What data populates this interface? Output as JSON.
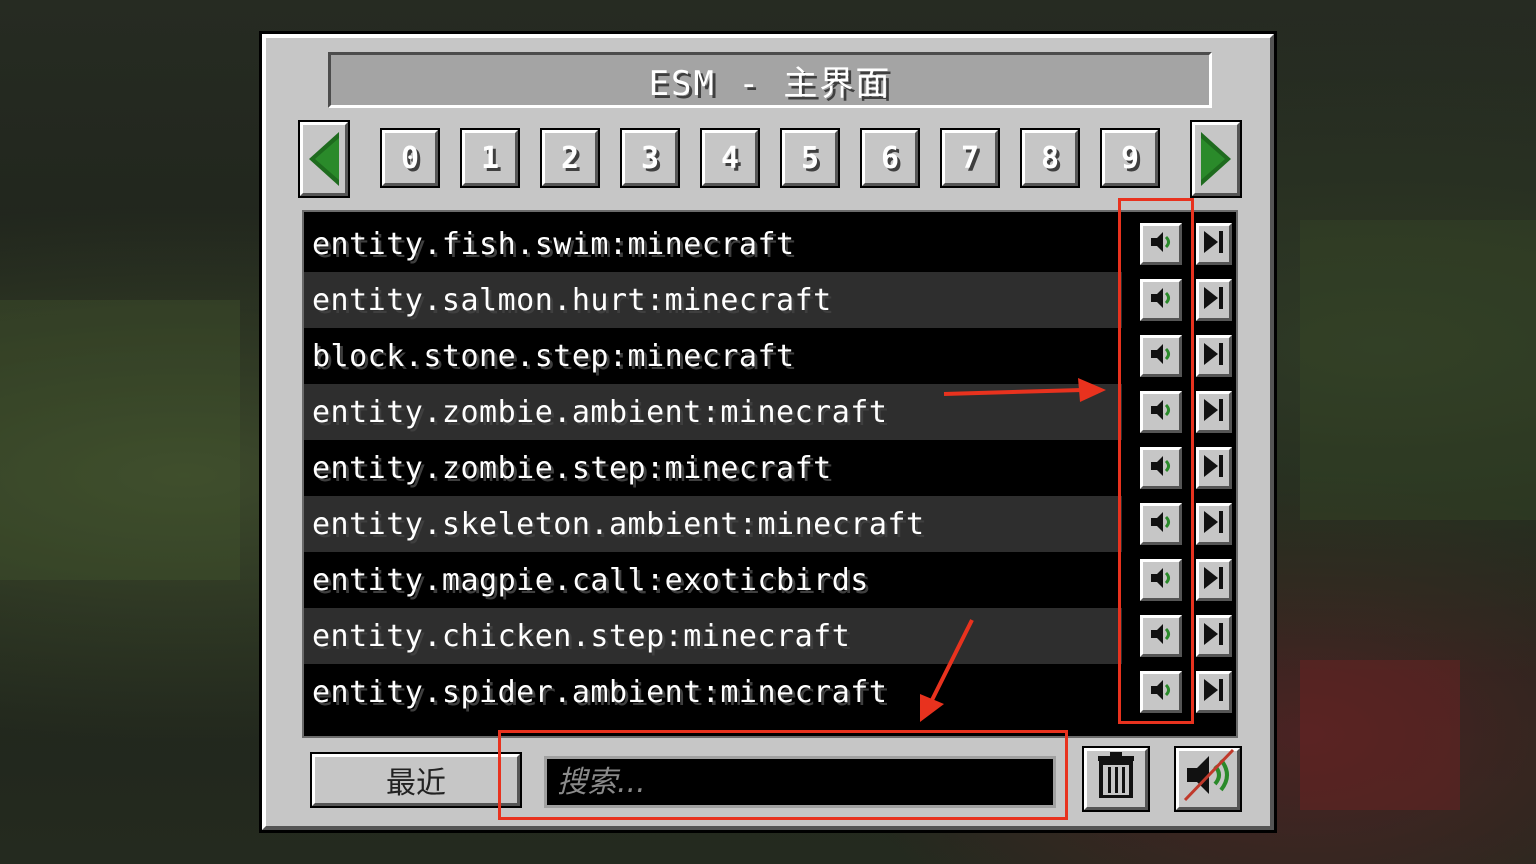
{
  "window": {
    "title": "ESM - 主界面"
  },
  "pagination": {
    "prev_icon": "green-left-arrow-icon",
    "next_icon": "green-right-arrow-icon",
    "pages": [
      "0",
      "1",
      "2",
      "3",
      "4",
      "5",
      "6",
      "7",
      "8",
      "9"
    ]
  },
  "sounds": [
    "entity.fish.swim:minecraft",
    "entity.salmon.hurt:minecraft",
    "block.stone.step:minecraft",
    "entity.zombie.ambient:minecraft",
    "entity.zombie.step:minecraft",
    "entity.skeleton.ambient:minecraft",
    "entity.magpie.call:exoticbirds",
    "entity.chicken.step:minecraft",
    "entity.spider.ambient:minecraft"
  ],
  "row_actions": {
    "play_icon": "speaker-icon",
    "stop_icon": "stop-end-icon"
  },
  "footer": {
    "recent_label": "最近",
    "search_placeholder": "搜索...",
    "trash_icon": "trash-icon",
    "mute_icon": "muted-speaker-icon"
  },
  "colors": {
    "panel": "#c6c6c6",
    "accent_green": "#1e6b1e",
    "annotation_red": "#e8321e",
    "list_bg": "#000000",
    "row_alt": "#2e2e2e"
  }
}
